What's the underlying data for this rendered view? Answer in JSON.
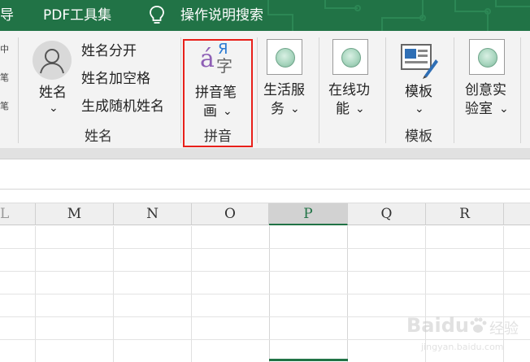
{
  "menubar": {
    "item_cut": "导",
    "pdf_tools": "PDF工具集",
    "search_ops": "操作说明搜索"
  },
  "ribbon": {
    "left_edge_labels": [
      "中",
      "笔",
      "笔"
    ],
    "name_group": {
      "name_button": "姓名",
      "split_name": "姓名分开",
      "add_space": "姓名加空格",
      "random_name": "生成随机姓名",
      "label": "姓名"
    },
    "pinyin_group": {
      "icon_glyph_a": "á",
      "icon_glyph_ya": "Я",
      "icon_glyph_zi": "字",
      "button_line1": "拼音笔",
      "button_line2": "画",
      "label": "拼音"
    },
    "life_group": {
      "button_line1": "生活服",
      "button_line2": "务"
    },
    "online_group": {
      "button_line1": "在线功",
      "button_line2": "能"
    },
    "template_group": {
      "button": "模板",
      "label": "模板"
    },
    "lab_group": {
      "button_line1": "创意实",
      "button_line2": "验室"
    },
    "dropdown_glyph": "⌄"
  },
  "grid": {
    "left_partial_header": "L",
    "columns": [
      "M",
      "N",
      "O",
      "P",
      "Q",
      "R"
    ],
    "selected_column": "P"
  },
  "watermark": {
    "brand": "Baidu",
    "cn": "经验",
    "url": "jingyan.baidu.com"
  },
  "colors": {
    "excel_green": "#217346",
    "highlight_red": "#e8201a"
  }
}
